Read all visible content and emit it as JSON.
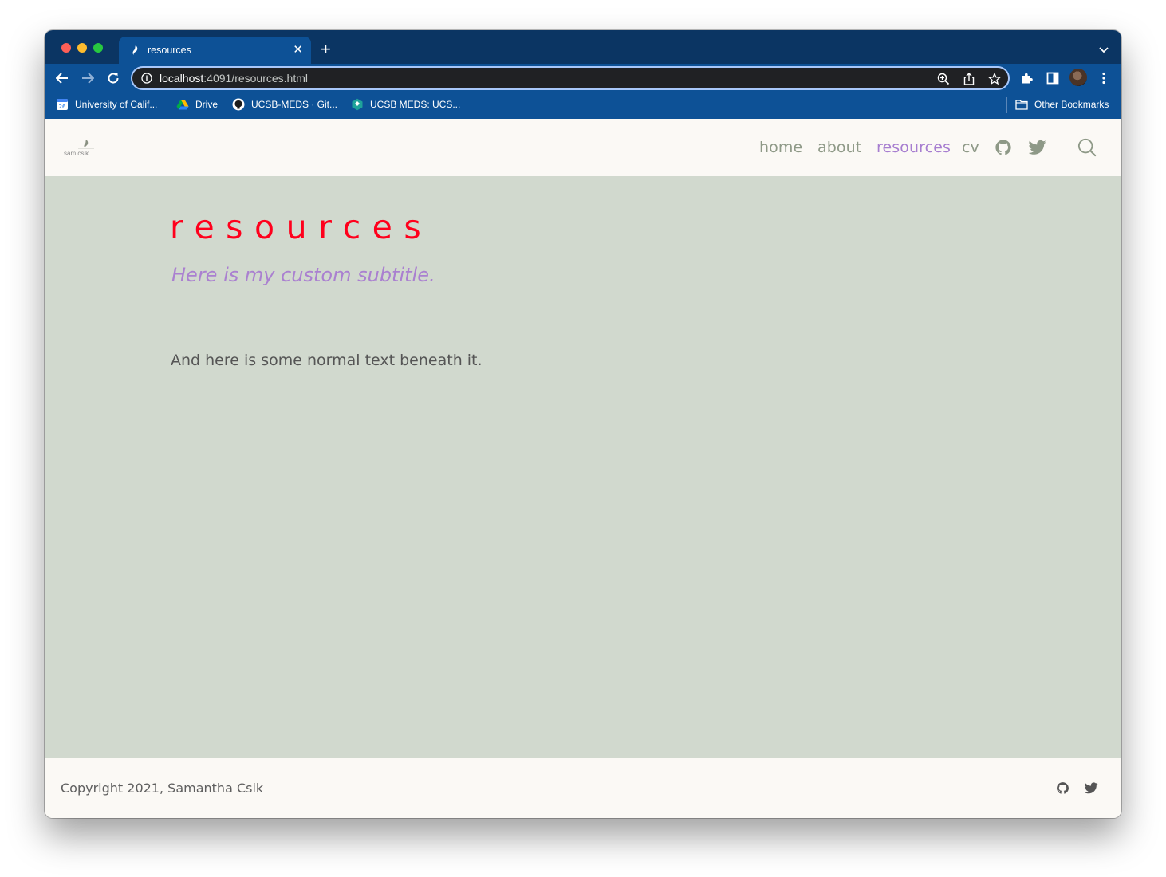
{
  "browser": {
    "tab": {
      "title": "resources",
      "close_label": "✕"
    },
    "new_tab_label": "+",
    "address": {
      "host": "localhost",
      "path": ":4091/resources.html"
    },
    "bookmarks": [
      {
        "label": "University of Calif...",
        "icon": "calendar-icon"
      },
      {
        "label": "Drive",
        "icon": "drive-icon"
      },
      {
        "label": "UCSB-MEDS · Git...",
        "icon": "github-icon"
      },
      {
        "label": "UCSB MEDS: UCS...",
        "icon": "classroom-icon"
      }
    ],
    "other_bookmarks": "Other Bookmarks"
  },
  "site": {
    "logo_text": "sam csik",
    "nav": [
      {
        "label": "home",
        "active": false
      },
      {
        "label": "about",
        "active": false
      },
      {
        "label": "resources",
        "active": true
      },
      {
        "label": "cv",
        "active": false
      }
    ],
    "nav_icons": [
      "github-icon",
      "twitter-icon",
      "search-icon"
    ],
    "colors": {
      "title": "#ff001c",
      "subtitle": "#aa80d0",
      "nav": "#8e9987",
      "nav_active": "#a77ed0",
      "content_bg": "#d1d9ce",
      "chrome_blue": "#0d5196"
    }
  },
  "main": {
    "title": "resources",
    "subtitle": "Here is my custom subtitle.",
    "body": "And here is some normal text beneath it."
  },
  "footer": {
    "copyright": "Copyright 2021, Samantha Csik",
    "icons": [
      "github-icon",
      "twitter-icon"
    ]
  }
}
